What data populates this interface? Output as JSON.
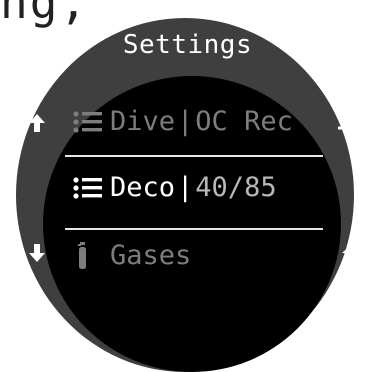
{
  "top_text": "ng,",
  "title": "Settings",
  "menu": [
    {
      "icon": "list-icon",
      "label": "Dive",
      "separator": "|",
      "value": "OC Rec",
      "state": "dimmed"
    },
    {
      "icon": "list-icon",
      "label": "Deco",
      "separator": "|",
      "value": "40/85",
      "state": "selected"
    },
    {
      "icon": "gas-cylinder-icon",
      "label": "Gases",
      "separator": "",
      "value": "",
      "state": "dimmed"
    }
  ],
  "side_buttons": {
    "left_top": "arrow-up-icon",
    "left_bottom": "arrow-down-icon",
    "right_top": "enter-icon",
    "right_bottom": "home-icon"
  },
  "colors": {
    "bezel": "#3f3f3f",
    "screen": "#000000",
    "text_selected": "#ffffff",
    "text_dimmed": "#7d7d7d",
    "divider": "#e6e6e6"
  }
}
